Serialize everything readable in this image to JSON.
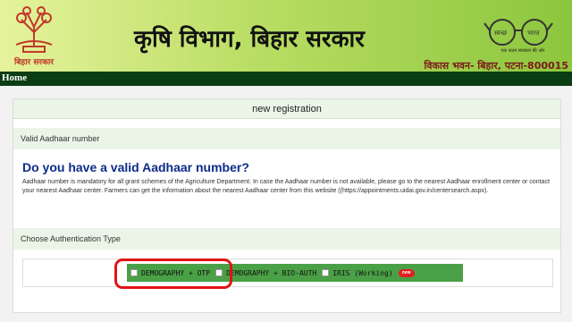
{
  "header": {
    "title": "कृषि विभाग, बिहार सरकार",
    "logo_caption": "बिहार सरकार",
    "address": "विकास भवन- बिहार, पटना-800015",
    "right_logo_tagline": "एक कदम स्वच्छता की ओर",
    "right_logo_words": [
      "स्वच्छ",
      "भारत"
    ]
  },
  "nav": {
    "home": "Home"
  },
  "panel": {
    "heading": "new registration",
    "section1_label": "Valid Aadhaar number",
    "question": "Do you have a valid Aadhaar number?",
    "description": "Aadhaar number is mandatory for all grant schemes of the Agriculture Department. In case the Aadhaar number is not available, please go to the nearest Aadhaar enrollment center or contact your nearest Aadhaar center. Farmers can get the information about the nearest Aadhaar center from this website ((https://appointments.uidai.gov.in/centersearch.aspx).",
    "section2_label": "Choose Authentication Type",
    "options": [
      {
        "label": "DEMOGRAPHY + OTP",
        "checked": false
      },
      {
        "label": "DEMOGRAPHY + BIO-AUTH",
        "checked": false
      },
      {
        "label": "IRIS (Working)",
        "checked": false
      }
    ],
    "new_badge": "new"
  },
  "colors": {
    "header_gradient_start": "#e6f39c",
    "header_gradient_end": "#8cc63e",
    "navbar": "#0b3d12",
    "question_text": "#0d2c8a",
    "options_bar": "#4aa046",
    "highlight": "#e01515"
  }
}
